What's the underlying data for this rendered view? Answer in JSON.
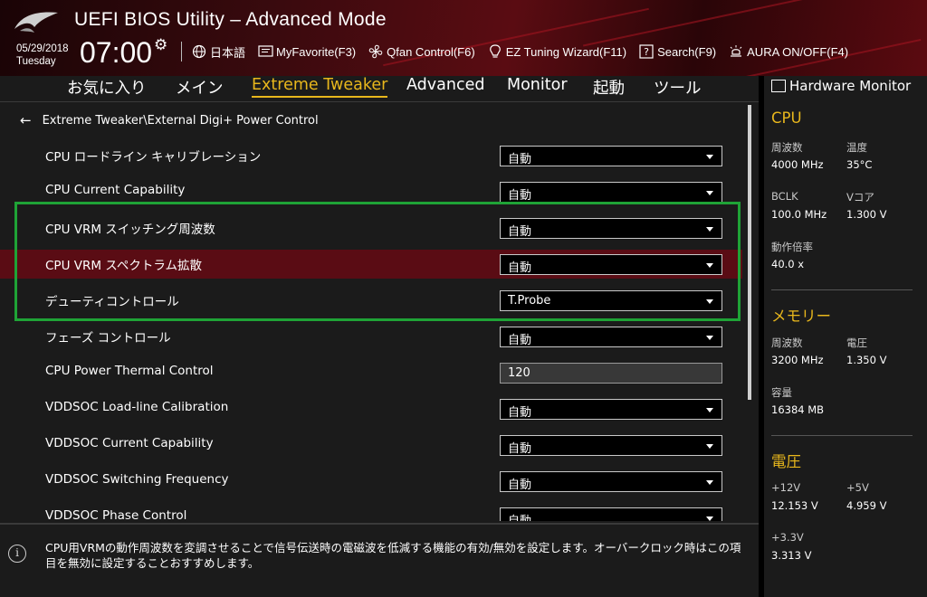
{
  "header": {
    "title": "UEFI BIOS Utility – Advanced Mode",
    "date": "05/29/2018",
    "day": "Tuesday",
    "time": "07:00",
    "toolbar": [
      {
        "label": "日本語",
        "icon": "globe-icon"
      },
      {
        "label": "MyFavorite(F3)",
        "icon": "favorite-icon"
      },
      {
        "label": "Qfan Control(F6)",
        "icon": "fan-icon"
      },
      {
        "label": "EZ Tuning Wizard(F11)",
        "icon": "bulb-icon"
      },
      {
        "label": "Search(F9)",
        "icon": "search-icon"
      },
      {
        "label": "AURA ON/OFF(F4)",
        "icon": "aura-icon"
      }
    ]
  },
  "tabs": [
    {
      "label": "お気に入り",
      "active": false
    },
    {
      "label": "メイン",
      "active": false
    },
    {
      "label": "Extreme Tweaker",
      "active": true
    },
    {
      "label": "Advanced",
      "active": false
    },
    {
      "label": "Monitor",
      "active": false
    },
    {
      "label": "起動",
      "active": false
    },
    {
      "label": "ツール",
      "active": false
    }
  ],
  "breadcrumb": "Extreme Tweaker\\External Digi+ Power Control",
  "settings": [
    {
      "label": "CPU ロードライン キャリブレーション",
      "value": "自動",
      "kind": "dropdown"
    },
    {
      "label": "CPU Current Capability",
      "value": "自動",
      "kind": "dropdown"
    },
    {
      "label": "CPU VRM スイッチング周波数",
      "value": "自動",
      "kind": "dropdown"
    },
    {
      "label": "CPU VRM スペクトラム拡散",
      "value": "自動",
      "kind": "dropdown",
      "selected": true
    },
    {
      "label": "デューティコントロール",
      "value": "T.Probe",
      "kind": "dropdown"
    },
    {
      "label": "フェーズ コントロール",
      "value": "自動",
      "kind": "dropdown"
    },
    {
      "label": "CPU Power Thermal Control",
      "value": "120",
      "kind": "input"
    },
    {
      "label": "VDDSOC Load-line Calibration",
      "value": "自動",
      "kind": "dropdown"
    },
    {
      "label": "VDDSOC Current Capability",
      "value": "自動",
      "kind": "dropdown"
    },
    {
      "label": "VDDSOC Switching Frequency",
      "value": "自動",
      "kind": "dropdown"
    },
    {
      "label": "VDDSOC Phase Control",
      "value": "自動",
      "kind": "dropdown"
    }
  ],
  "help_text": "CPU用VRMの動作周波数を変調させることで信号伝送時の電磁波を低減する機能の有効/無効を設定します。オーバークロック時はこの項目を無効に設定することおすすめします。",
  "hardware_monitor": {
    "title": "Hardware Monitor",
    "cpu": {
      "heading": "CPU",
      "freq_label": "周波数",
      "freq": "4000 MHz",
      "temp_label": "温度",
      "temp": "35°C",
      "bclk_label": "BCLK",
      "bclk": "100.0 MHz",
      "vcore_label": "Vコア",
      "vcore": "1.300 V",
      "ratio_label": "動作倍率",
      "ratio": "40.0 x"
    },
    "memory": {
      "heading": "メモリー",
      "freq_label": "周波数",
      "freq": "3200 MHz",
      "volt_label": "電圧",
      "volt": "1.350 V",
      "cap_label": "容量",
      "cap": "16384 MB"
    },
    "voltage": {
      "heading": "電圧",
      "v12_label": "+12V",
      "v12": "12.153 V",
      "v5_label": "+5V",
      "v5": "4.959 V",
      "v33_label": "+3.3V",
      "v33": "3.313 V"
    }
  },
  "colors": {
    "accent": "#e8b71c",
    "highlight_row": "#5a0c14",
    "annotation_box": "#1fa336"
  }
}
